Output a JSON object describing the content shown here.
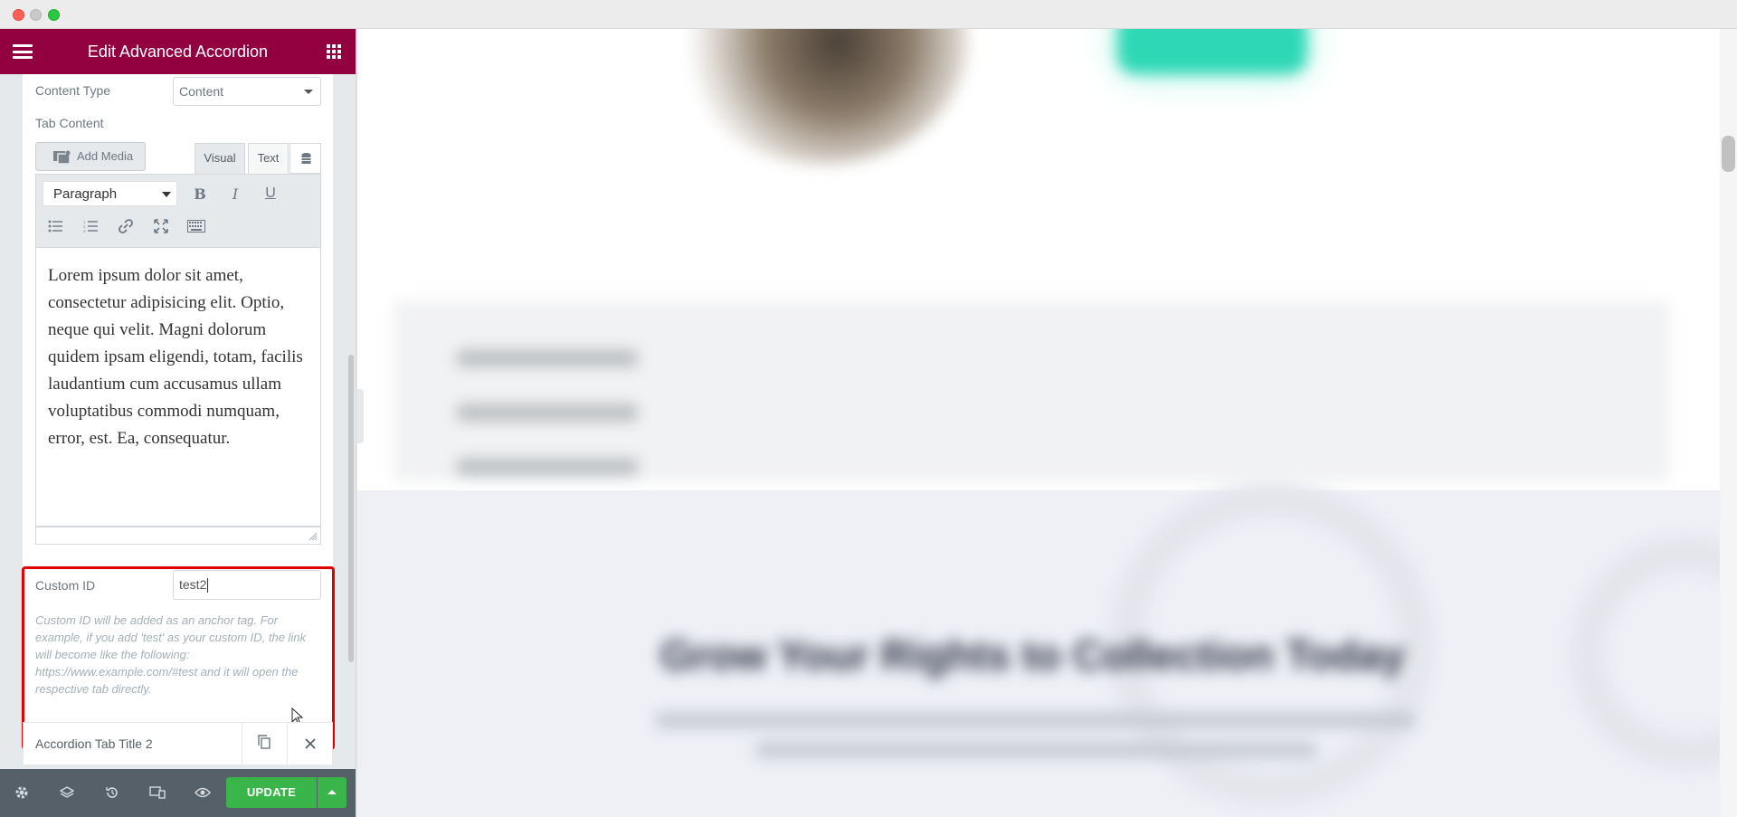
{
  "panel": {
    "title": "Edit Advanced Accordion",
    "content_type_label": "Content Type",
    "content_type_value": "Content",
    "tab_content_label": "Tab Content",
    "add_media_label": "Add Media",
    "tab_visual_label": "Visual",
    "tab_text_label": "Text",
    "format_value": "Paragraph",
    "editor_text": "Lorem ipsum dolor sit amet, consectetur adipisicing elit. Optio, neque qui velit. Magni dolorum quidem ipsam eligendi, totam, facilis laudantium cum accusamus ullam voluptatibus commodi numquam, error, est. Ea, consequatur.",
    "custom_id_label": "Custom ID",
    "custom_id_value": "test2",
    "custom_id_help": "Custom ID will be added as an anchor tag. For example, if you add 'test' as your custom ID, the link will become like the following: https://www.example.com/#test and it will open the respective tab directly.",
    "repeater_title": "Accordion Tab Title 2",
    "update_label": "UPDATE"
  },
  "preview": {
    "headline": "Grow Your Rights to Collection Today"
  },
  "colors": {
    "header": "#93003f",
    "update": "#39b54a",
    "highlight": "#e00000"
  }
}
